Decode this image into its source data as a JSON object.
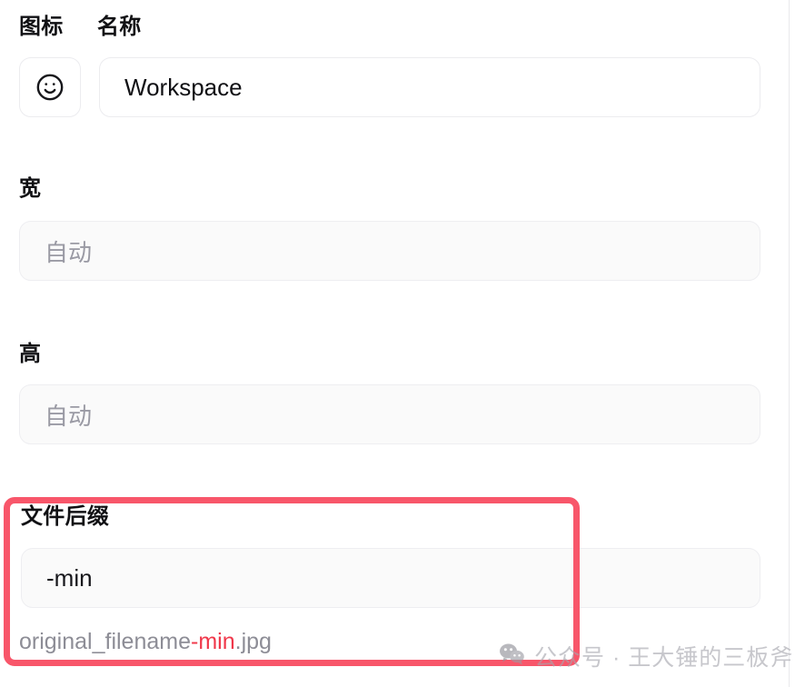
{
  "panel": {
    "fields": {
      "icon_label": "图标",
      "name_label": "名称",
      "name_value": "Workspace",
      "icon_glyph": "smiley-face-icon",
      "width_label": "宽",
      "width_placeholder": "自动",
      "height_label": "高",
      "height_placeholder": "自动",
      "suffix_label": "文件后缀",
      "suffix_value": "-min",
      "hint_prefix": "original_filename",
      "hint_highlight": "-min",
      "hint_suffix": ".jpg"
    }
  },
  "highlight": {
    "color": "#f8566a"
  },
  "watermark": {
    "text": "公众号 · 王大锤的三板斧",
    "icon": "wechat-icon"
  },
  "colors": {
    "accent_red": "#f8566a",
    "hint_red": "#f0374a",
    "text_primary": "#111114",
    "text_muted": "#9a9aa4",
    "input_bg": "#fafafa",
    "border": "#ececef"
  }
}
